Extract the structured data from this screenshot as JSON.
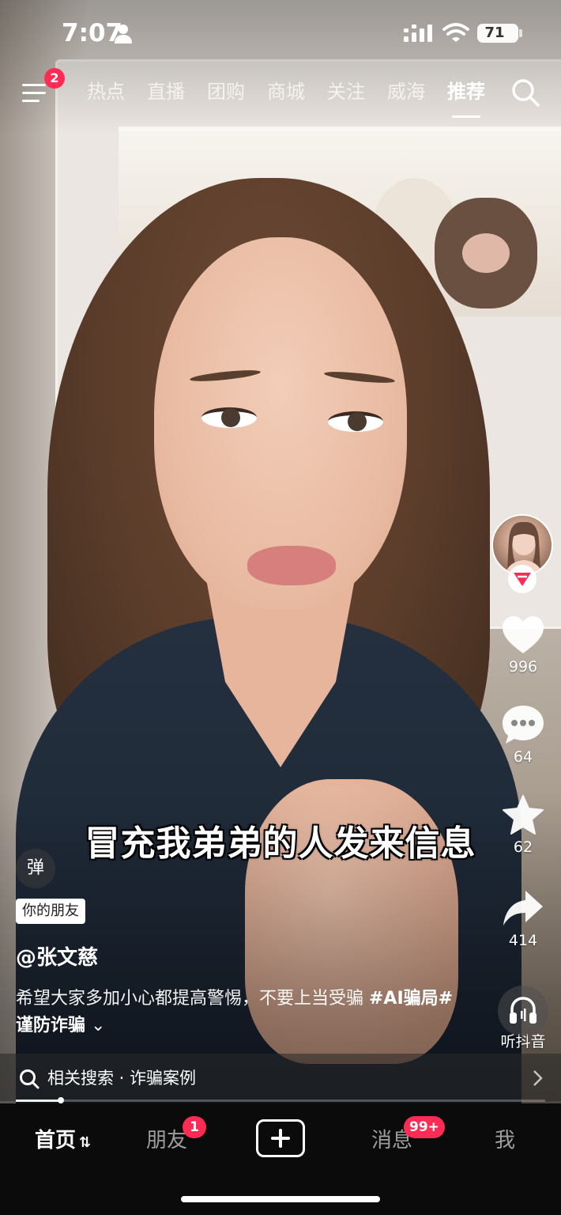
{
  "status_bar": {
    "time": "7:07",
    "battery": "71"
  },
  "top_nav": {
    "menu_badge": "2",
    "tabs": [
      {
        "label": "热点",
        "active": false
      },
      {
        "label": "直播",
        "active": false
      },
      {
        "label": "团购",
        "active": false
      },
      {
        "label": "商城",
        "active": false
      },
      {
        "label": "关注",
        "active": false
      },
      {
        "label": "威海",
        "active": false
      },
      {
        "label": "推荐",
        "active": true
      }
    ]
  },
  "video": {
    "subtitle": "冒充我弟弟的人发来信息",
    "danmu_label": "弹",
    "friend_tag": "你的朋友",
    "author": "@张文慈",
    "caption_text": "希望大家多加小心都提高警惕，不要上当受骗 ",
    "caption_hashtag1": "#AI骗局",
    "caption_hashtag2": "#谨防诈骗",
    "caption_more": "⌄",
    "progress": 0.085
  },
  "actions": {
    "likes": "996",
    "comments": "64",
    "favorites": "62",
    "shares": "414",
    "listen_label": "听抖音"
  },
  "related_search": {
    "text": "相关搜索 · 诈骗案例"
  },
  "bottom_nav": {
    "home": "首页",
    "home_suffix": "⇅",
    "friends": "朋友",
    "friends_badge": "1",
    "messages": "消息",
    "messages_badge": "99+",
    "me": "我"
  },
  "colors": {
    "accent": "#fe2c55",
    "bottom_bar": "#0b0b0b"
  },
  "icons": [
    "person-icon",
    "signal-icon",
    "wifi-icon",
    "battery-icon",
    "menu-icon",
    "search-icon",
    "follow-icon",
    "heart-icon",
    "comment-icon",
    "star-icon",
    "share-icon",
    "headphones-icon",
    "chevron-right-icon",
    "plus-icon"
  ]
}
